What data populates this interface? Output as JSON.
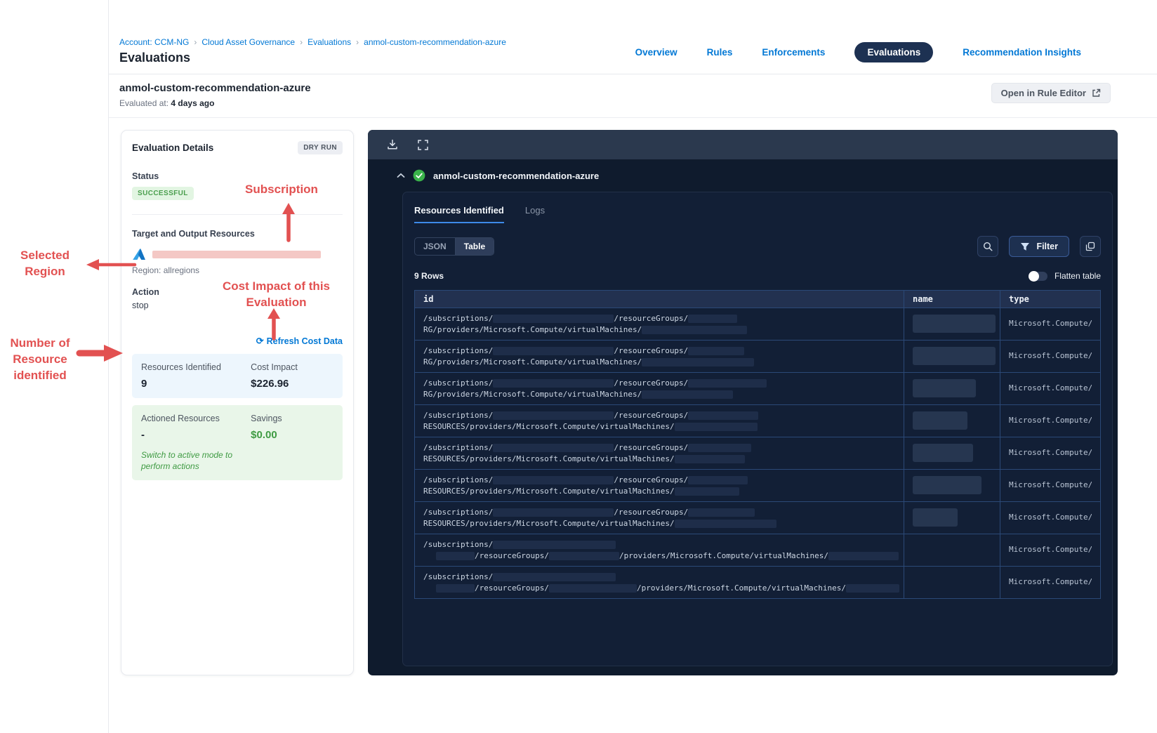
{
  "colors": {
    "accent_blue": "#0278d5",
    "nav_pill_navy": "#1d3152",
    "success_green": "#4a9e4d",
    "savings_green": "#3f9b43",
    "annotation_red": "#e25151",
    "redaction_pink": "#f4c8c5",
    "panel_dark": "#0f1b2d",
    "tab_underline_blue": "#3d8ae8"
  },
  "icons": {
    "refresh_glyph": "⟳",
    "breadcrumb_separator": "›"
  },
  "header": {
    "breadcrumb": {
      "separator": "›",
      "items": [
        "Account: CCM-NG",
        "Cloud Asset Governance",
        "Evaluations",
        "anmol-custom-recommendation-azure"
      ]
    },
    "page_title": "Evaluations",
    "nav_tabs": [
      {
        "label": "Overview",
        "active": false
      },
      {
        "label": "Rules",
        "active": false
      },
      {
        "label": "Enforcements",
        "active": false
      },
      {
        "label": "Evaluations",
        "active": true
      },
      {
        "label": "Recommendation Insights",
        "active": false
      }
    ]
  },
  "subheader": {
    "title": "anmol-custom-recommendation-azure",
    "evaluated_at_label": "Evaluated at:",
    "evaluated_at_value": "4 days ago",
    "open_rule_editor_label": "Open in Rule Editor"
  },
  "evaluation_details": {
    "title": "Evaluation Details",
    "mode_badge": "DRY RUN",
    "status_label": "Status",
    "status_value": "SUCCESSFUL",
    "target_label": "Target and Output Resources",
    "region": "Region: allregions",
    "action_label": "Action",
    "action_value": "stop",
    "refresh_link": "Refresh Cost Data",
    "stats": {
      "resources_identified_label": "Resources Identified",
      "resources_identified_value": "9",
      "cost_impact_label": "Cost Impact",
      "cost_impact_value": "$226.96",
      "actioned_label": "Actioned Resources",
      "actioned_value": "-",
      "savings_label": "Savings",
      "savings_value": "$0.00",
      "note": "Switch to active mode to perform actions"
    }
  },
  "results_panel": {
    "result_title": "anmol-custom-recommendation-azure",
    "tabs": [
      {
        "label": "Resources Identified",
        "active": true
      },
      {
        "label": "Logs",
        "active": false
      }
    ],
    "view_toggle": [
      {
        "label": "JSON",
        "active": false
      },
      {
        "label": "Table",
        "active": true
      }
    ],
    "filter_label": "Filter",
    "rows_count": "9 Rows",
    "flatten_label": "Flatten table",
    "table": {
      "columns": [
        "id",
        "name",
        "type"
      ],
      "rows": [
        {
          "line1": [
            "t:/subscriptions/",
            "r:172",
            "t:/resourceGroups/",
            "r:70"
          ],
          "line2": [
            "t:RG/providers/Microsoft.Compute/virtualMachines/",
            "r:150"
          ],
          "name_redact": 118,
          "type": "Microsoft.Compute/virtu"
        },
        {
          "line1": [
            "t:/subscriptions/",
            "r:172",
            "t:/resourceGroups/",
            "r:80"
          ],
          "line2": [
            "t:RG/providers/Microsoft.Compute/virtualMachines/",
            "r:160"
          ],
          "name_redact": 118,
          "type": "Microsoft.Compute/virtu"
        },
        {
          "line1": [
            "t:/subscriptions/",
            "r:172",
            "t:/resourceGroups/",
            "r:112"
          ],
          "line2": [
            "t:RG/providers/Microsoft.Compute/virtualMachines/",
            "r:130"
          ],
          "name_redact": 90,
          "type": "Microsoft.Compute/virtu"
        },
        {
          "line1": [
            "t:/subscriptions/",
            "r:172",
            "t:/resourceGroups/",
            "r:100"
          ],
          "line2": [
            "t:RESOURCES/providers/Microsoft.Compute/virtualMachines/",
            "r:118"
          ],
          "name_redact": 78,
          "type": "Microsoft.Compute/virtu"
        },
        {
          "line1": [
            "t:/subscriptions/",
            "r:172",
            "t:/resourceGroups/",
            "r:90"
          ],
          "line2": [
            "t:RESOURCES/providers/Microsoft.Compute/virtualMachines/",
            "r:100"
          ],
          "name_redact": 86,
          "type": "Microsoft.Compute/virtu"
        },
        {
          "line1": [
            "t:/subscriptions/",
            "r:172",
            "t:/resourceGroups/",
            "r:85"
          ],
          "line2": [
            "t:RESOURCES/providers/Microsoft.Compute/virtualMachines/",
            "r:92"
          ],
          "name_redact": 98,
          "type": "Microsoft.Compute/virtu"
        },
        {
          "line1": [
            "t:/subscriptions/",
            "r:172",
            "t:/resourceGroups/",
            "r:95"
          ],
          "line2": [
            "t:RESOURCES/providers/Microsoft.Compute/virtualMachines/",
            "r:145"
          ],
          "name_redact": 64,
          "type": "Microsoft.Compute/virtu"
        },
        {
          "line1": [
            "t:/subscriptions/",
            "r:175"
          ],
          "line2": [
            "s:18",
            "r:55",
            "t:/resourceGroups/",
            "r:100",
            "t:/providers/Microsoft.Compute/virtualMachines/",
            "r:100"
          ],
          "name_redact": 0,
          "type": "Microsoft.Compute/virtu"
        },
        {
          "line1": [
            "t:/subscriptions/",
            "r:175"
          ],
          "line2": [
            "s:18",
            "r:55",
            "t:/resourceGroups/",
            "r:125",
            "t:/providers/Microsoft.Compute/virtualMachines/",
            "r:76"
          ],
          "name_redact": 0,
          "type": "Microsoft.Compute/virtu"
        }
      ]
    }
  },
  "annotations": {
    "subscription": "Subscription",
    "selected_region": "Selected Region",
    "cost_impact": "Cost Impact of this Evaluation",
    "resource_count": "Number of Resource identified"
  }
}
